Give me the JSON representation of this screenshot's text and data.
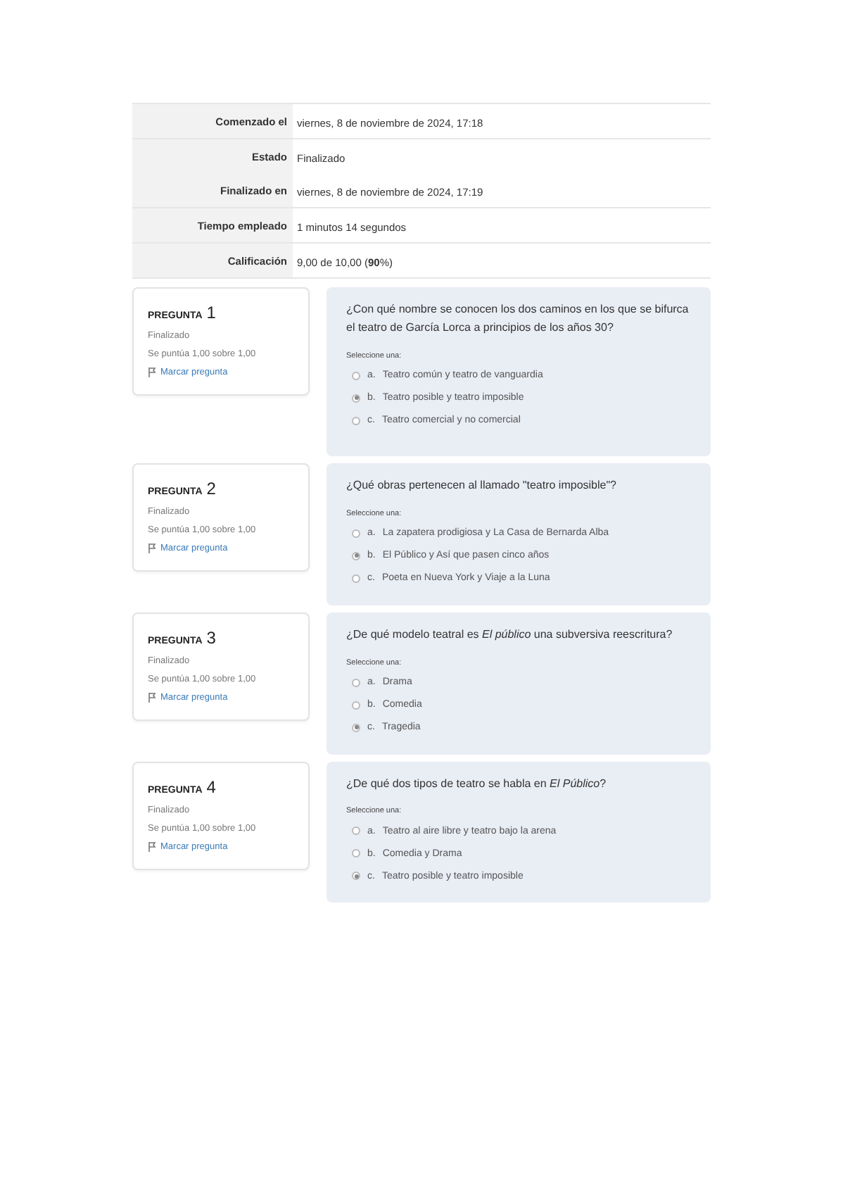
{
  "summary": [
    {
      "label": "Comenzado el",
      "value": "viernes, 8 de noviembre de 2024, 17:18"
    },
    {
      "label": "Estado",
      "value": "Finalizado",
      "extra_label": "Finalizado en",
      "extra_value": "viernes, 8 de noviembre de 2024, 17:19"
    },
    {
      "label": "Tiempo empleado",
      "value": "1 minutos 14 segundos"
    },
    {
      "label": "Calificación",
      "value": "9,00 de 10,00 (**90**%)"
    }
  ],
  "questions": [
    {
      "heading": "PREGUNTA",
      "number": "1",
      "status": "Finalizado",
      "score": "Se puntúa 1,00 sobre 1,00",
      "flag": "Marcar pregunta",
      "text": "¿Con qué nombre se conocen los dos caminos en los que se bifurca el teatro de García Lorca a principios de los años 30?",
      "prompt": "Seleccione una:",
      "options": [
        {
          "letter": "a.",
          "text": "Teatro común y teatro de vanguardia",
          "selected": false
        },
        {
          "letter": "b.",
          "text": "Teatro posible y teatro imposible",
          "selected": true
        },
        {
          "letter": "c.",
          "text": "Teatro comercial y no comercial",
          "selected": false
        }
      ]
    },
    {
      "heading": "PREGUNTA",
      "number": "2",
      "status": "Finalizado",
      "score": "Se puntúa 1,00 sobre 1,00",
      "flag": "Marcar pregunta",
      "text": "¿Qué obras pertenecen al llamado \"teatro imposible\"?",
      "prompt": "Seleccione una:",
      "options": [
        {
          "letter": "a.",
          "text": "La zapatera prodigiosa y La Casa de Bernarda Alba",
          "selected": false
        },
        {
          "letter": "b.",
          "text": "El Público y Así que pasen cinco años",
          "selected": true
        },
        {
          "letter": "c.",
          "text": "Poeta en Nueva York y Viaje a la Luna",
          "selected": false
        }
      ]
    },
    {
      "heading": "PREGUNTA",
      "number": "3",
      "status": "Finalizado",
      "score": "Se puntúa 1,00 sobre 1,00",
      "flag": "Marcar pregunta",
      "text": "¿De qué modelo teatral es *El público* una subversiva reescritura?",
      "prompt": "Seleccione una:",
      "options": [
        {
          "letter": "a.",
          "text": "Drama",
          "selected": false
        },
        {
          "letter": "b.",
          "text": "Comedia",
          "selected": false
        },
        {
          "letter": "c.",
          "text": "Tragedia",
          "selected": true
        }
      ]
    },
    {
      "heading": "PREGUNTA",
      "number": "4",
      "status": "Finalizado",
      "score": "Se puntúa 1,00 sobre 1,00",
      "flag": "Marcar pregunta",
      "text": "¿De qué dos tipos de teatro se habla en *El Público*?",
      "prompt": "Seleccione una:",
      "options": [
        {
          "letter": "a.",
          "text": "Teatro al aire libre y teatro bajo la arena",
          "selected": false
        },
        {
          "letter": "b.",
          "text": "Comedia y Drama",
          "selected": false
        },
        {
          "letter": "c.",
          "text": "Teatro posible y teatro imposible",
          "selected": true
        }
      ]
    }
  ]
}
